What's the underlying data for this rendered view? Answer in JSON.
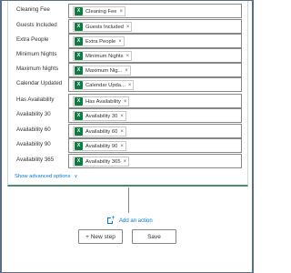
{
  "rows": [
    {
      "label": "Cleaning Fee",
      "token": "Cleaning Fee"
    },
    {
      "label": "Guests Included",
      "token": "Guests Included"
    },
    {
      "label": "Extra People",
      "token": "Extra People"
    },
    {
      "label": "Minimum Nights",
      "token": "Minimum Nights"
    },
    {
      "label": "Maximum Nights",
      "token": "Maximum Nig..."
    },
    {
      "label": "Calendar Updated",
      "token": "Calendar Upda..."
    },
    {
      "label": "Has Availability",
      "token": "Has Availability"
    },
    {
      "label": "Availability 30",
      "token": "Availability 30"
    },
    {
      "label": "Availability 60",
      "token": "Availability 60"
    },
    {
      "label": "Availability 90",
      "token": "Availability 90"
    },
    {
      "label": "Availability 365",
      "token": "Availability 365"
    }
  ],
  "token_remove_glyph": "×",
  "advanced_options": "Show advanced options",
  "add_action": "Add an action",
  "new_step": "+ New step",
  "save": "Save",
  "colors": {
    "accent": "#0078d4",
    "excel": "#107c41",
    "card_border_bottom": "#4c8c6c"
  }
}
